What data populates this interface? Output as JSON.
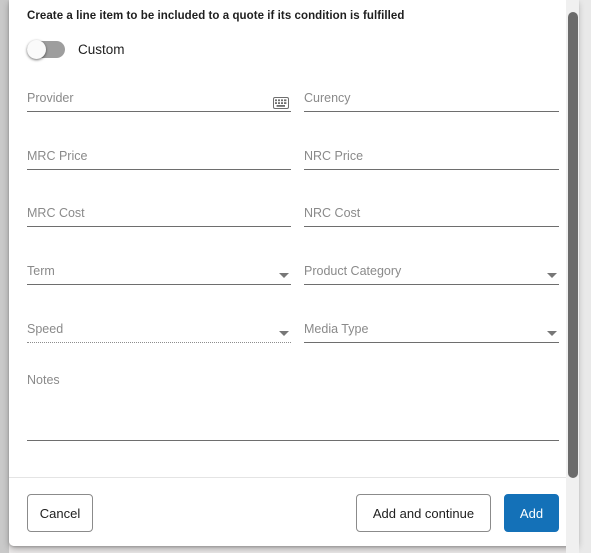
{
  "dialog": {
    "heading": "Create a line item to be included to a quote if its condition is fulfilled",
    "custom_toggle": {
      "label": "Custom",
      "state": "off"
    },
    "fields": [
      {
        "name": "provider",
        "label": "Provider",
        "value": "",
        "type": "text",
        "icon": "keyboard-icon",
        "column": "left",
        "row": 1,
        "disabled": false
      },
      {
        "name": "currency",
        "label": "Curency",
        "value": "",
        "type": "text",
        "icon": "",
        "column": "right",
        "row": 1,
        "disabled": false
      },
      {
        "name": "mrc-price",
        "label": "MRC Price",
        "value": "",
        "type": "text",
        "icon": "",
        "column": "left",
        "row": 2,
        "disabled": false
      },
      {
        "name": "nrc-price",
        "label": "NRC Price",
        "value": "",
        "type": "text",
        "icon": "",
        "column": "right",
        "row": 2,
        "disabled": false
      },
      {
        "name": "mrc-cost",
        "label": "MRC Cost",
        "value": "",
        "type": "text",
        "icon": "",
        "column": "left",
        "row": 3,
        "disabled": false
      },
      {
        "name": "nrc-cost",
        "label": "NRC Cost",
        "value": "",
        "type": "text",
        "icon": "",
        "column": "right",
        "row": 3,
        "disabled": false
      },
      {
        "name": "term",
        "label": "Term",
        "value": "",
        "type": "select",
        "icon": "chevron-down-icon",
        "column": "left",
        "row": 4,
        "disabled": false
      },
      {
        "name": "product-category",
        "label": "Product Category",
        "value": "",
        "type": "select",
        "icon": "chevron-down-icon",
        "column": "right",
        "row": 4,
        "disabled": false
      },
      {
        "name": "speed",
        "label": "Speed",
        "value": "",
        "type": "select",
        "icon": "chevron-down-icon",
        "column": "left",
        "row": 5,
        "disabled": true
      },
      {
        "name": "media-type",
        "label": "Media Type",
        "value": "",
        "type": "select",
        "icon": "chevron-down-icon",
        "column": "right",
        "row": 5,
        "disabled": false
      }
    ],
    "notes": {
      "label": "Notes",
      "value": ""
    },
    "footer": {
      "cancel_label": "Cancel",
      "add_and_continue_label": "Add and continue",
      "add_label": "Add"
    }
  },
  "colors": {
    "primary": "#1471b8",
    "field_underline": "#6e6e6e",
    "placeholder": "#8a8a8a",
    "toggle_track_off": "#9e9e9e",
    "scrollbar_thumb": "#6b6b6b"
  },
  "scrollbar": {
    "orientation": "vertical",
    "thumb_position": "top"
  }
}
